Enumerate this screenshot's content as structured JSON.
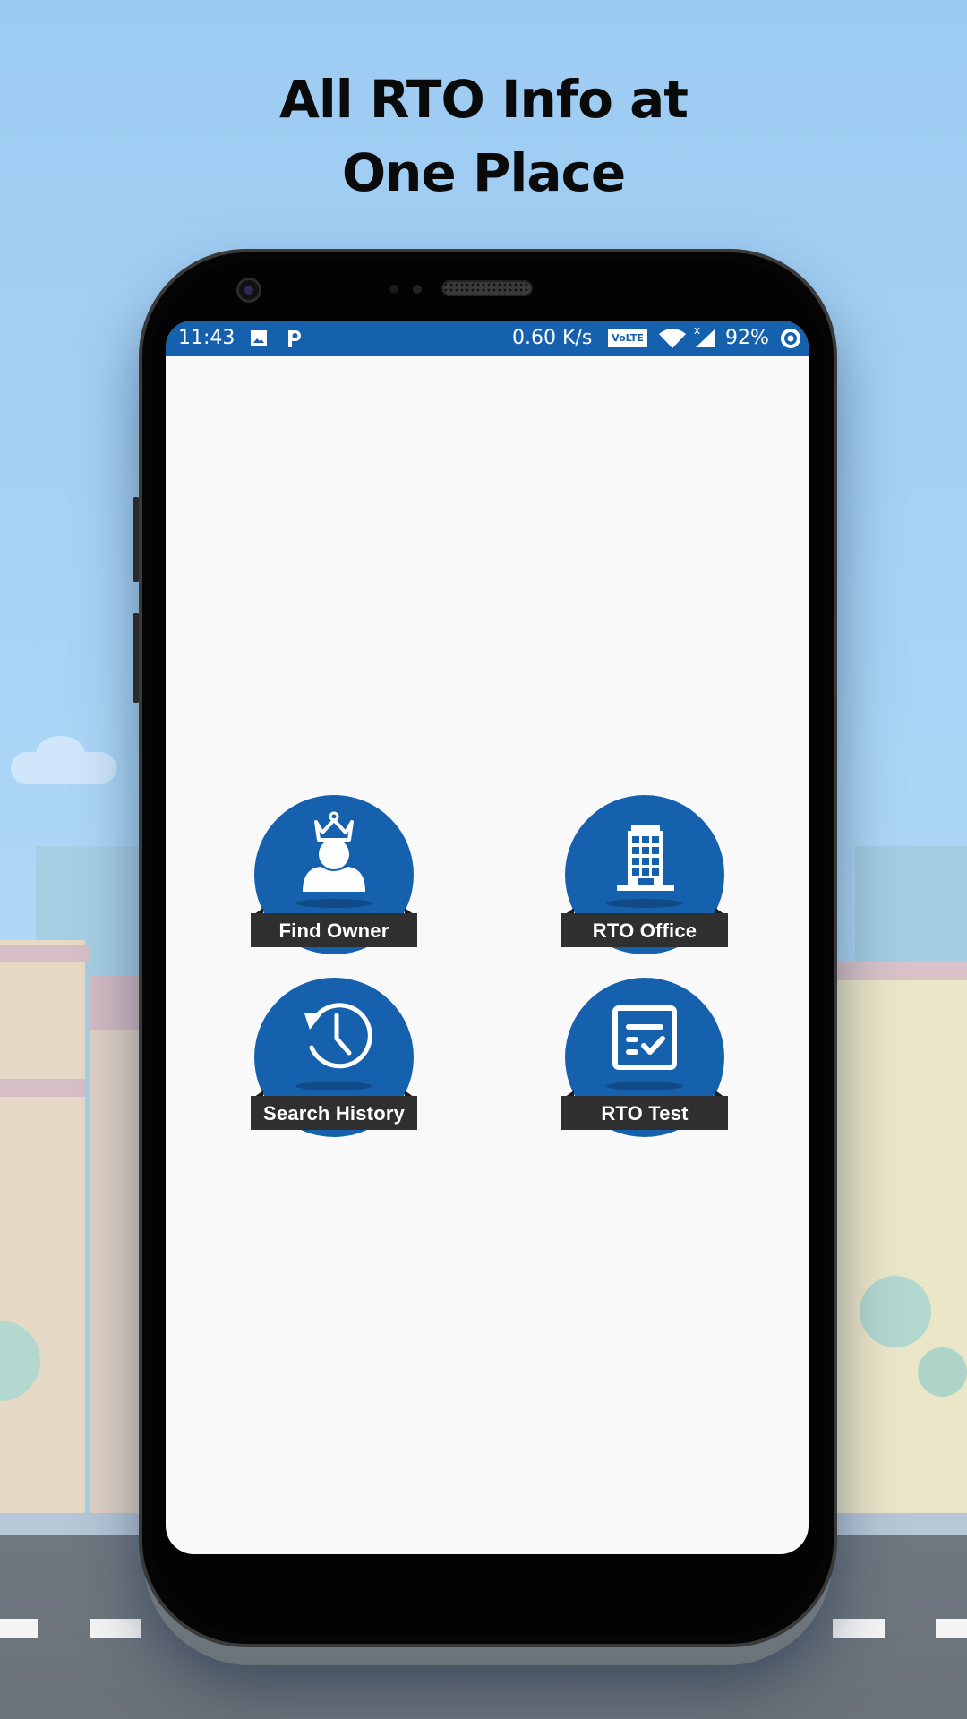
{
  "promo": {
    "headline_line1": "All RTO Info at",
    "headline_line2": "One Place"
  },
  "status_bar": {
    "time": "11:43",
    "notification_icons": [
      "image-icon",
      "parking-p-icon"
    ],
    "network_speed": "0.60 K/s",
    "volte_badge": "VoLTE",
    "signal_extra": "x",
    "battery": "92%",
    "icons": [
      "volte-icon",
      "wifi-icon",
      "signal-icon",
      "battery-ring-icon"
    ]
  },
  "menu": {
    "items": [
      {
        "label": "Find Owner",
        "icon": "crowned-user-icon"
      },
      {
        "label": "RTO Office",
        "icon": "office-building-icon"
      },
      {
        "label": "Search History",
        "icon": "history-clock-icon"
      },
      {
        "label": "RTO Test",
        "icon": "checklist-icon"
      }
    ]
  },
  "colors": {
    "primary_blue": "#1661ae",
    "label_bg": "#2f2f2f",
    "screen_bg": "#f9f9f9",
    "sky": "#a9d4f5"
  }
}
